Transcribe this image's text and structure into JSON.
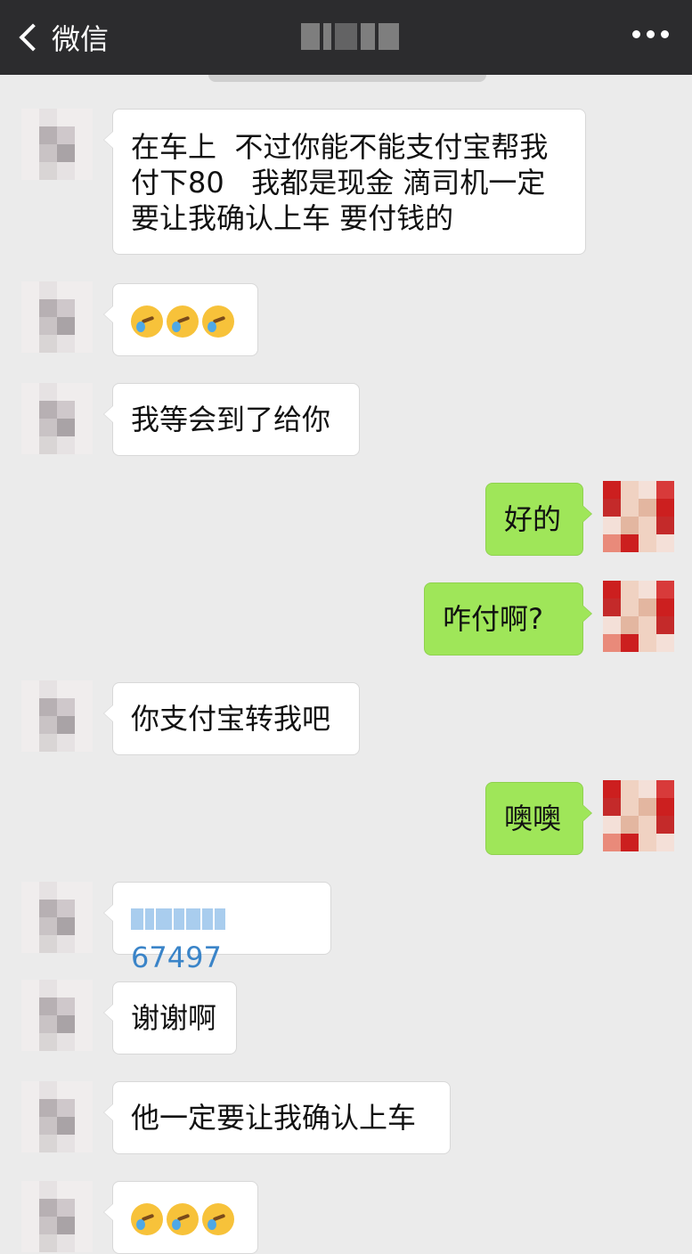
{
  "header": {
    "back_label": "微信",
    "title": ""
  },
  "messages": [
    {
      "side": "left",
      "kind": "text",
      "text": "在车上  不过你能不能支付宝帮我\n付下80   我都是现金 滴司机一定\n要让我确认上车 要付钱的"
    },
    {
      "side": "left",
      "kind": "emoji",
      "emoji": [
        "facepalm-cry-emoji",
        "facepalm-cry-emoji",
        "facepalm-cry-emoji"
      ]
    },
    {
      "side": "left",
      "kind": "text",
      "text": "我等会到了给你"
    },
    {
      "side": "right",
      "kind": "text",
      "text": "好的"
    },
    {
      "side": "right",
      "kind": "text",
      "text": "咋付啊?"
    },
    {
      "side": "left",
      "kind": "text",
      "text": "你支付宝转我吧"
    },
    {
      "side": "right",
      "kind": "text",
      "text": "噢噢"
    },
    {
      "side": "left",
      "kind": "link",
      "text": "67497"
    },
    {
      "side": "left",
      "kind": "text",
      "text": "谢谢啊"
    },
    {
      "side": "left",
      "kind": "text",
      "text": "他一定要让我确认上车"
    },
    {
      "side": "left",
      "kind": "emoji",
      "emoji": [
        "facepalm-cry-emoji",
        "facepalm-cry-emoji",
        "facepalm-cry-emoji"
      ]
    }
  ],
  "colors": {
    "header_bg": "#2c2c2e",
    "chat_bg": "#ebebeb",
    "bubble_self": "#9fe659",
    "bubble_other": "#ffffff",
    "link": "#3a84c8"
  }
}
